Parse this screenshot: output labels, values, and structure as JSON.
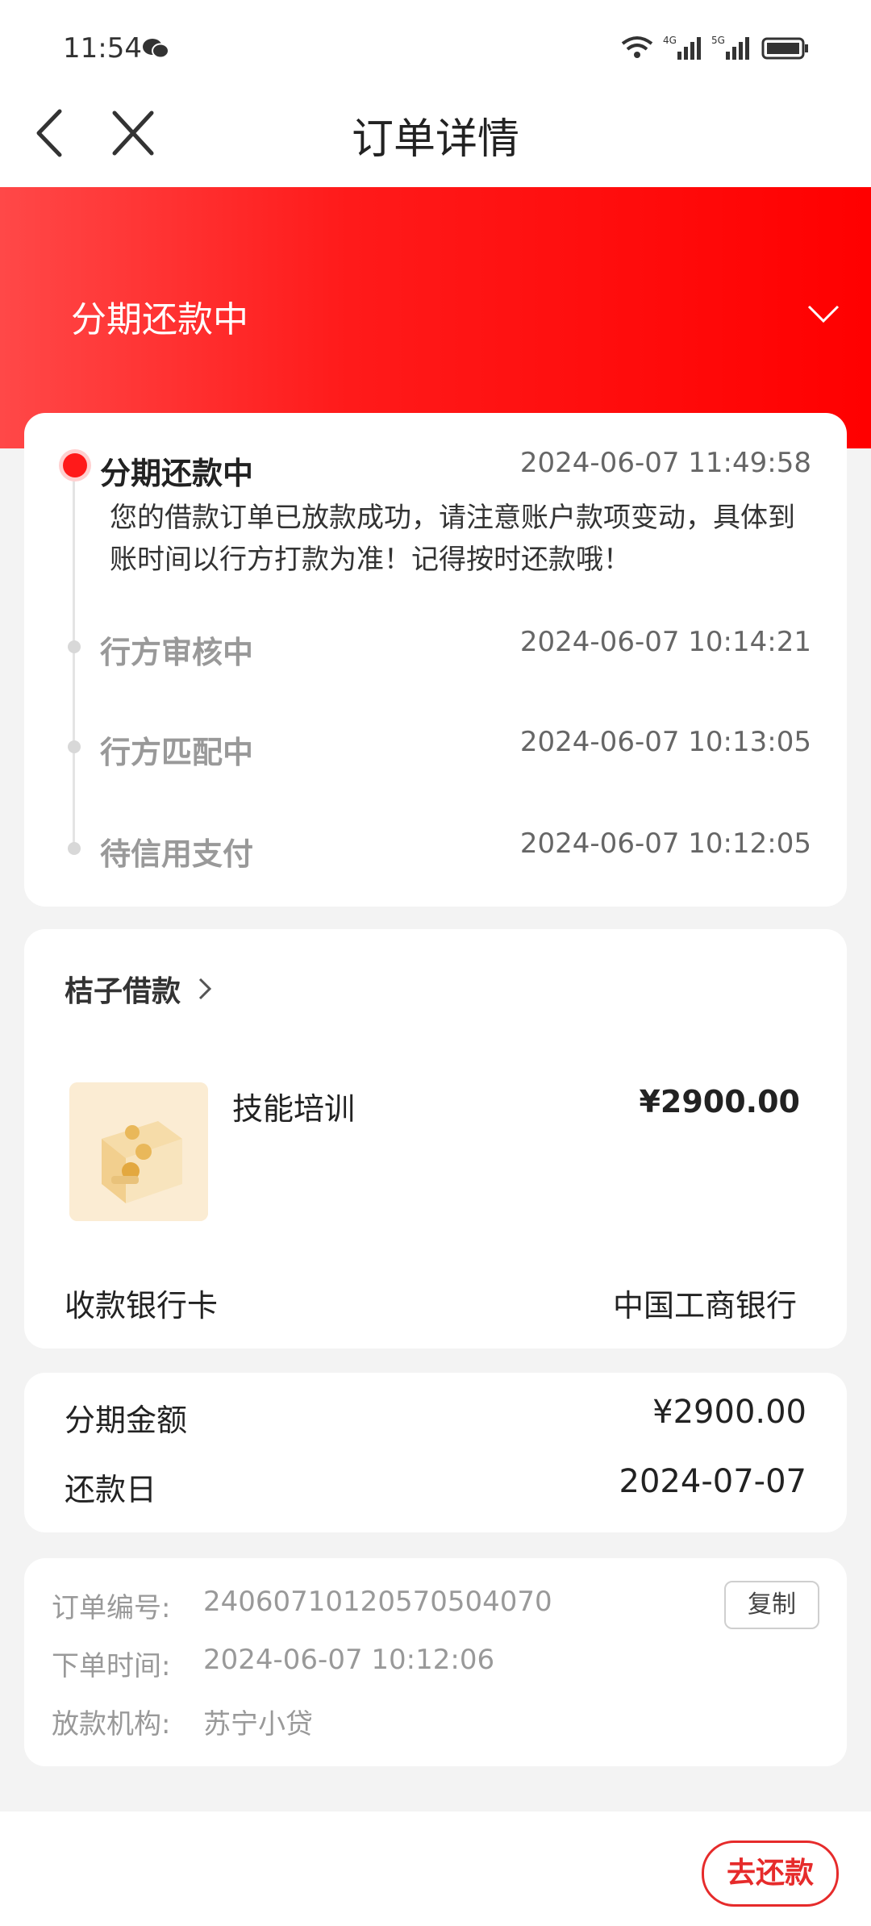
{
  "status_bar": {
    "time": "11:54",
    "network_1": "4G",
    "network_2": "5G"
  },
  "header": {
    "title": "订单详情"
  },
  "banner": {
    "status": "分期还款中"
  },
  "timeline": [
    {
      "title": "分期还款中",
      "time": "2024-06-07 11:49:58",
      "active": true,
      "desc": "您的借款订单已放款成功，请注意账户款项变动，具体到账时间以行方打款为准！记得按时还款哦！"
    },
    {
      "title": "行方审核中",
      "time": "2024-06-07 10:14:21",
      "active": false
    },
    {
      "title": "行方匹配中",
      "time": "2024-06-07 10:13:05",
      "active": false
    },
    {
      "title": "待信用支付",
      "time": "2024-06-07 10:12:05",
      "active": false
    }
  ],
  "product": {
    "store": "桔子借款",
    "name": "技能培训",
    "price": "¥2900.00",
    "bank_label": "收款银行卡",
    "bank_value": "中国工商银行"
  },
  "amount": {
    "installment_label": "分期金额",
    "installment_value": "¥2900.00",
    "due_label": "还款日",
    "due_value": "2024-07-07"
  },
  "order_info": {
    "order_no_label": "订单编号:",
    "order_no": "24060710120570504070",
    "order_time_label": "下单时间:",
    "order_time": "2024-06-07 10:12:06",
    "lender_label": "放款机构:",
    "lender": "苏宁小贷",
    "copy_label": "复制"
  },
  "bottom": {
    "repay_label": "去还款"
  },
  "colors": {
    "brand_red": "#ff1a1a",
    "card_bg": "#ffffff",
    "page_bg": "#f3f3f3"
  }
}
